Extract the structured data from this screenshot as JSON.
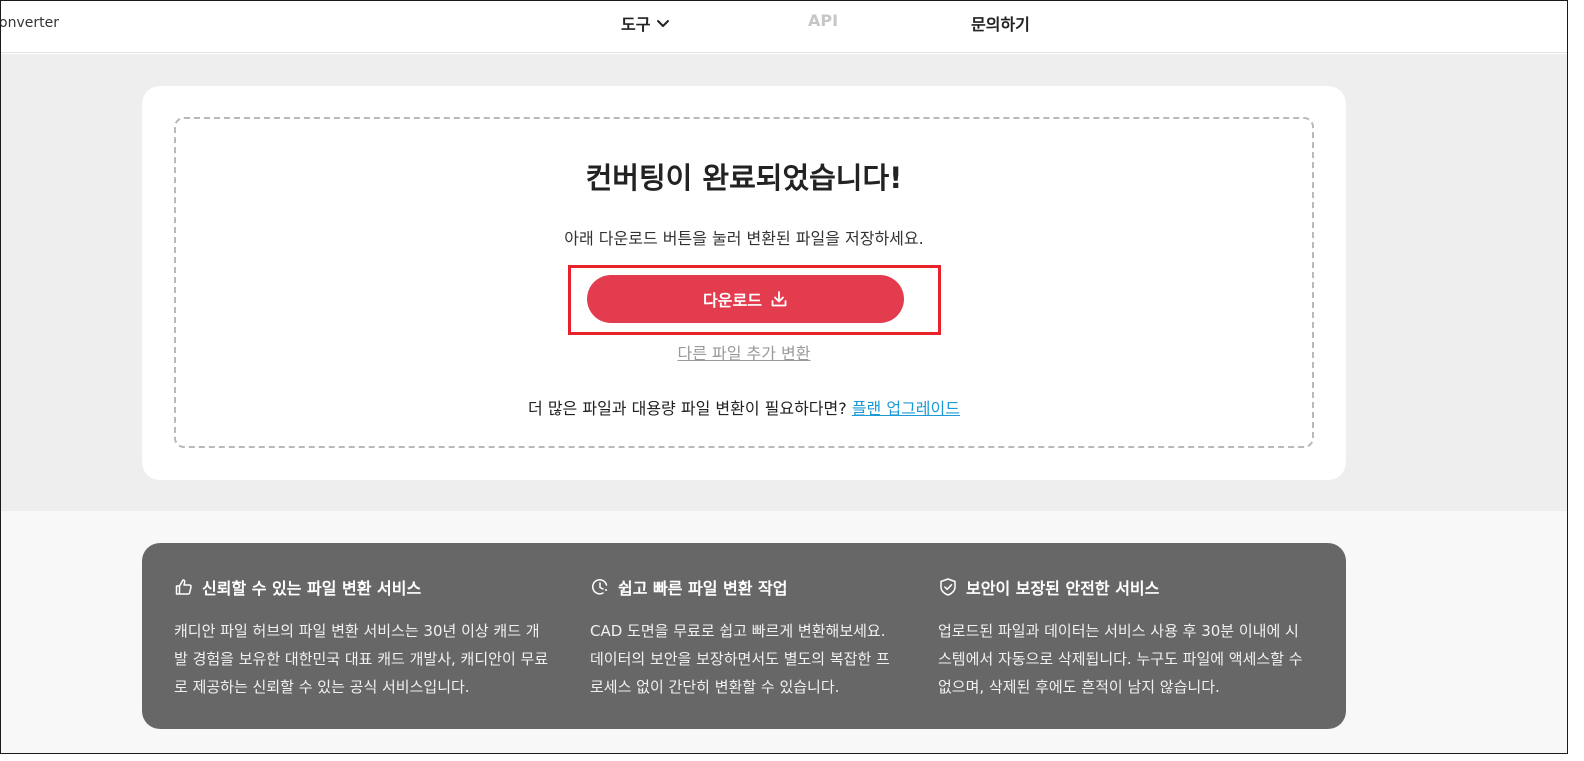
{
  "header": {
    "logo_text": "onverter",
    "nav": {
      "tools": "도구",
      "api": "API",
      "contact": "문의하기"
    }
  },
  "result": {
    "title": "컨버팅이 완료되었습니다!",
    "subtitle": "아래 다운로드 버튼을 눌러 변환된 파일을 저장하세요.",
    "download_label": "다운로드",
    "add_more_label": "다른 파일 추가 변환",
    "upgrade_text": "더 많은 파일과 대용량 파일 변환이 필요하다면?",
    "upgrade_link": "플랜 업그레이드"
  },
  "features": [
    {
      "icon": "thumbs-up-icon",
      "title": "신뢰할 수 있는 파일 변환 서비스",
      "lines": [
        "캐디안 파일 허브의 파일 변환 서비스는 30년 이상 캐드 개",
        "발 경험을 보유한 대한민국 대표 캐드 개발사, 캐디안이 무료",
        "로 제공하는 신뢰할 수 있는 공식 서비스입니다."
      ]
    },
    {
      "icon": "clock-icon",
      "title": "쉽고 빠른 파일 변환 작업",
      "lines": [
        "CAD 도면을 무료로 쉽고 빠르게 변환해보세요.",
        "데이터의 보안을 보장하면서도 별도의 복잡한 프",
        "로세스 없이 간단히 변환할 수 있습니다."
      ]
    },
    {
      "icon": "shield-check-icon",
      "title": "보안이 보장된 안전한 서비스",
      "lines": [
        "업로드된 파일과 데이터는 서비스 사용 후 30분 이내에 시",
        "스템에서 자동으로 삭제됩니다. 누구도 파일에 액세스할 수",
        "없으며, 삭제된 후에도 흔적이 남지 않습니다."
      ]
    }
  ],
  "colors": {
    "accent": "#e33c4f",
    "highlight_border": "#e8222b",
    "link": "#1b9ad6",
    "info_card": "#676767"
  }
}
